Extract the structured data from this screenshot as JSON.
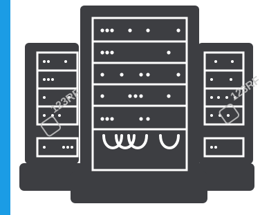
{
  "image": {
    "subject": "server-racks-icon",
    "background_color": "#1b9ce5",
    "canvas_color": "#ffffff",
    "icon_color": "#3d3e42",
    "highlight_color": "#ffffff"
  },
  "watermark": {
    "left_text": "123RF",
    "right_text": "123RF",
    "color": "#c8c8c8"
  }
}
